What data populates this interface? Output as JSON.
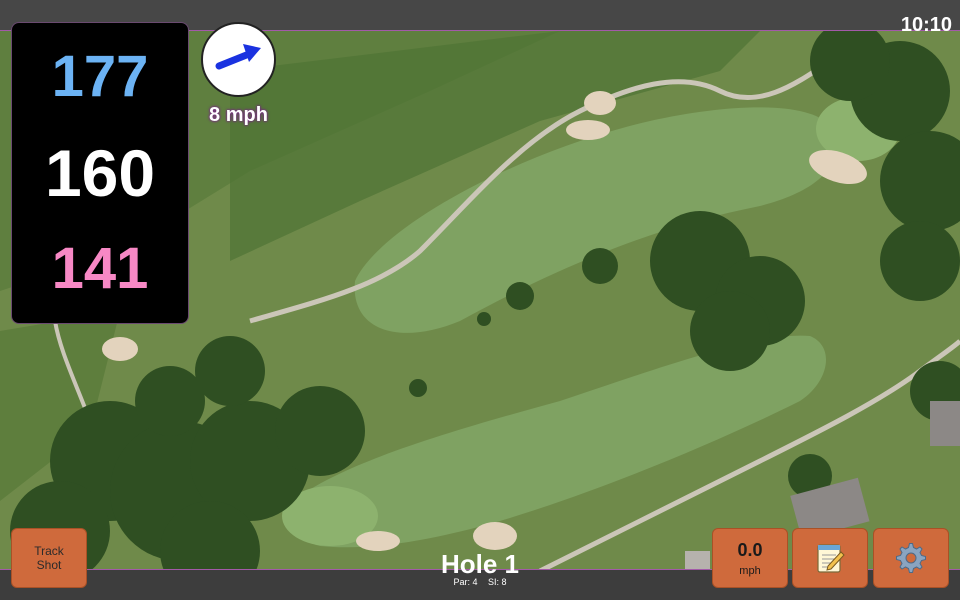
{
  "status_bar": {
    "time": "10:10"
  },
  "distances": {
    "back": "177",
    "center": "160",
    "front": "141"
  },
  "wind": {
    "speed_label": "8 mph",
    "direction_icon": "wind-arrow-icon"
  },
  "buttons": {
    "track_shot": [
      "Track",
      "Shot"
    ],
    "wind_value": "0.0",
    "wind_unit": "mph",
    "notes_icon": "notepad-icon",
    "settings_icon": "gear-icon"
  },
  "hole": {
    "title": "Hole 1",
    "par_label": "Par: 4",
    "si_label": "SI: 8"
  },
  "colors": {
    "back": "#6cb3f4",
    "center": "#ffffff",
    "front": "#f788c5",
    "button": "#cf6a3c",
    "accent": "#a35aa8"
  }
}
